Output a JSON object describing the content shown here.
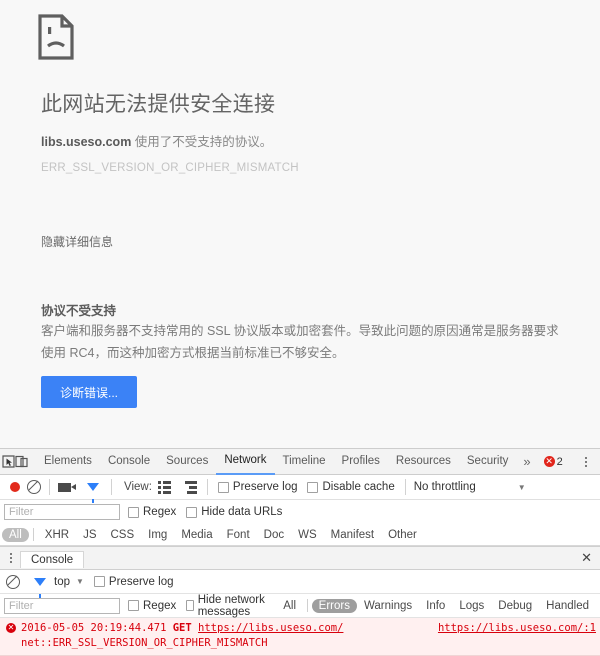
{
  "error_page": {
    "icon": "sad-document-icon",
    "title": "此网站无法提供安全连接",
    "subtitle_host": "libs.useso.com",
    "subtitle_rest": " 使用了不受支持的协议。",
    "error_code": "ERR_SSL_VERSION_OR_CIPHER_MISMATCH",
    "details_toggle": "隐藏详细信息",
    "details_heading": "协议不受支持",
    "details_body": "客户端和服务器不支持常用的 SSL 协议版本或加密套件。导致此问题的原因通常是服务器要求使用 RC4，而这种加密方式根据当前标准已不够安全。",
    "diagnose_button": "诊断错误...",
    "accent_color": "#3b82f6"
  },
  "devtools": {
    "tabs": [
      {
        "label": "Elements",
        "active": false
      },
      {
        "label": "Console",
        "active": false
      },
      {
        "label": "Sources",
        "active": false
      },
      {
        "label": "Network",
        "active": true
      },
      {
        "label": "Timeline",
        "active": false
      },
      {
        "label": "Profiles",
        "active": false
      },
      {
        "label": "Resources",
        "active": false
      },
      {
        "label": "Security",
        "active": false
      }
    ],
    "more_tabs_glyph": "»",
    "error_count": "2",
    "error_badge_glyph": "✕",
    "close_glyph": "✕",
    "left_icons": [
      "inspect-element-icon",
      "device-toolbar-icon"
    ],
    "network_toolbar": {
      "record_icon": "record-icon",
      "clear_icon": "clear-icon",
      "capture_screenshots_icon": "camera-icon",
      "filter_icon": "funnel-icon",
      "view_label": "View:",
      "view_list_icon": "list-view-icon",
      "view_waterfall_icon": "waterfall-view-icon",
      "preserve_log_label": "Preserve log",
      "preserve_log_checked": false,
      "disable_cache_label": "Disable cache",
      "disable_cache_checked": false,
      "throttling_value": "No throttling",
      "caret_glyph": "▼"
    },
    "network_filter": {
      "filter_placeholder": "Filter",
      "filter_value": "",
      "regex_label": "Regex",
      "regex_checked": false,
      "hide_data_urls_label": "Hide data URLs",
      "hide_data_urls_checked": false
    },
    "resource_types": [
      {
        "label": "All",
        "selected": true
      },
      {
        "label": "XHR",
        "selected": false
      },
      {
        "label": "JS",
        "selected": false
      },
      {
        "label": "CSS",
        "selected": false
      },
      {
        "label": "Img",
        "selected": false
      },
      {
        "label": "Media",
        "selected": false
      },
      {
        "label": "Font",
        "selected": false
      },
      {
        "label": "Doc",
        "selected": false
      },
      {
        "label": "WS",
        "selected": false
      },
      {
        "label": "Manifest",
        "selected": false
      },
      {
        "label": "Other",
        "selected": false
      }
    ],
    "drawer": {
      "tab_label": "Console",
      "close_glyph": "✕",
      "clear_icon": "clear-icon",
      "filter_icon": "funnel-icon",
      "context_value": "top",
      "caret_glyph": "▼",
      "preserve_log_label": "Preserve log",
      "preserve_log_checked": false,
      "filter_placeholder": "Filter",
      "filter_value": "",
      "regex_label": "Regex",
      "regex_checked": false,
      "hide_network_messages_label": "Hide network messages",
      "hide_network_messages_checked": false,
      "levels": [
        {
          "label": "All",
          "selected": false
        },
        {
          "label": "Errors",
          "selected": true
        },
        {
          "label": "Warnings",
          "selected": false
        },
        {
          "label": "Info",
          "selected": false
        },
        {
          "label": "Logs",
          "selected": false
        },
        {
          "label": "Debug",
          "selected": false
        },
        {
          "label": "Handled",
          "selected": false
        }
      ],
      "messages": [
        {
          "badge_glyph": "✕",
          "timestamp": "2016-05-05 20:19:44.471",
          "method": "GET",
          "url": "https://libs.useso.com/",
          "detail": "net::ERR_SSL_VERSION_OR_CIPHER_MISMATCH",
          "source_link": "https://libs.useso.com/:1"
        }
      ]
    }
  }
}
